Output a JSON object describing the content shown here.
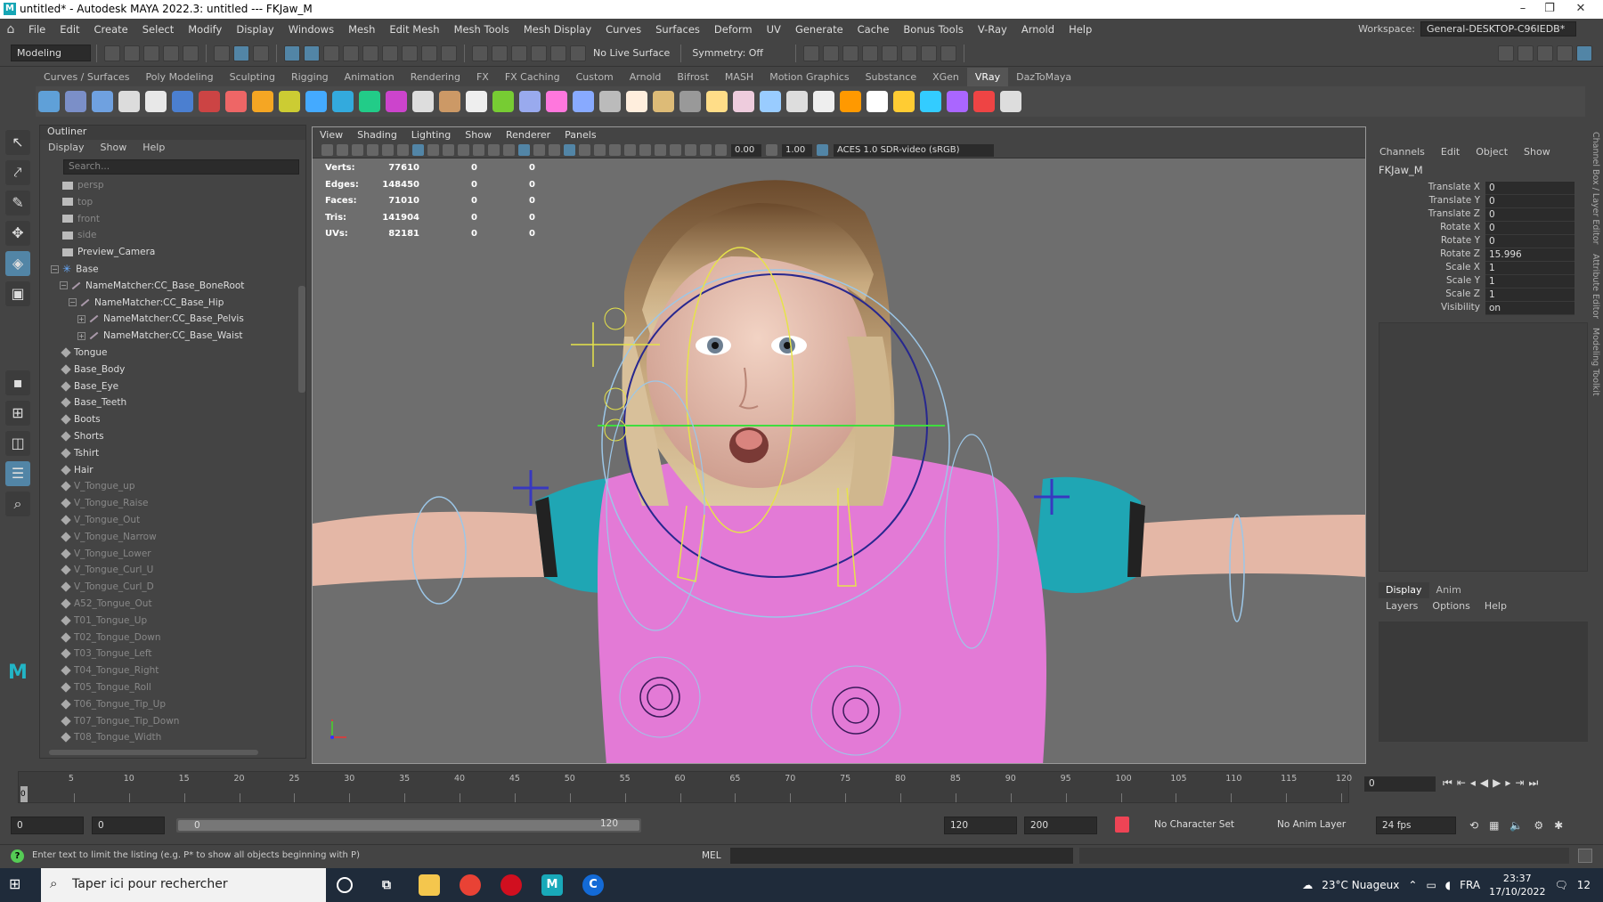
{
  "titlebar": {
    "title": "untitled* - Autodesk MAYA 2022.3: untitled  ---  FKJaw_M",
    "logo": "M",
    "minimize_icon": "–",
    "restore_icon": "❐",
    "close_icon": "✕"
  },
  "menubar": {
    "items": [
      "File",
      "Edit",
      "Create",
      "Select",
      "Modify",
      "Display",
      "Windows",
      "Mesh",
      "Edit Mesh",
      "Mesh Tools",
      "Mesh Display",
      "Curves",
      "Surfaces",
      "Deform",
      "UV",
      "Generate",
      "Cache",
      "Bonus Tools",
      "V-Ray",
      "Arnold",
      "Help"
    ],
    "workspace_label": "Workspace:",
    "workspace_value": "General-DESKTOP-C96IEDB*"
  },
  "statusline": {
    "mode": "Modeling",
    "live_surface": "No Live Surface",
    "symmetry": "Symmetry: Off"
  },
  "shelf": {
    "tabs": [
      "Curves / Surfaces",
      "Poly Modeling",
      "Sculpting",
      "Rigging",
      "Animation",
      "Rendering",
      "FX",
      "FX Caching",
      "Custom",
      "Arnold",
      "Bifrost",
      "MASH",
      "Motion Graphics",
      "Substance",
      "XGen",
      "VRay",
      "DazToMaya"
    ],
    "active_tab": "VRay"
  },
  "outliner": {
    "title": "Outliner",
    "menu": [
      "Display",
      "Show",
      "Help"
    ],
    "search_placeholder": "Search...",
    "items": [
      {
        "label": "persp",
        "type": "camera",
        "indent": 1,
        "dim": true
      },
      {
        "label": "top",
        "type": "camera",
        "indent": 1,
        "dim": true
      },
      {
        "label": "front",
        "type": "camera",
        "indent": 1,
        "dim": true
      },
      {
        "label": "side",
        "type": "camera",
        "indent": 1,
        "dim": true
      },
      {
        "label": "Preview_Camera",
        "type": "camera",
        "indent": 1,
        "dim": false
      },
      {
        "label": "Base",
        "type": "cross",
        "indent": 1,
        "dim": false,
        "expander": "−"
      },
      {
        "label": "NameMatcher:CC_Base_BoneRoot",
        "type": "joint",
        "indent": 2,
        "dim": false,
        "expander": "−"
      },
      {
        "label": "NameMatcher:CC_Base_Hip",
        "type": "joint",
        "indent": 3,
        "dim": false,
        "expander": "−"
      },
      {
        "label": "NameMatcher:CC_Base_Pelvis",
        "type": "joint",
        "indent": 4,
        "dim": false,
        "expander": "+"
      },
      {
        "label": "NameMatcher:CC_Base_Waist",
        "type": "joint",
        "indent": 4,
        "dim": false,
        "expander": "+"
      },
      {
        "label": "Tongue",
        "type": "mesh",
        "indent": 1,
        "dim": false
      },
      {
        "label": "Base_Body",
        "type": "mesh",
        "indent": 1,
        "dim": false
      },
      {
        "label": "Base_Eye",
        "type": "mesh",
        "indent": 1,
        "dim": false
      },
      {
        "label": "Base_Teeth",
        "type": "mesh",
        "indent": 1,
        "dim": false
      },
      {
        "label": "Boots",
        "type": "mesh",
        "indent": 1,
        "dim": false
      },
      {
        "label": "Shorts",
        "type": "mesh",
        "indent": 1,
        "dim": false
      },
      {
        "label": "Tshirt",
        "type": "mesh",
        "indent": 1,
        "dim": false
      },
      {
        "label": "Hair",
        "type": "mesh",
        "indent": 1,
        "dim": false
      },
      {
        "label": "V_Tongue_up",
        "type": "mesh",
        "indent": 1,
        "dim": true
      },
      {
        "label": "V_Tongue_Raise",
        "type": "mesh",
        "indent": 1,
        "dim": true
      },
      {
        "label": "V_Tongue_Out",
        "type": "mesh",
        "indent": 1,
        "dim": true
      },
      {
        "label": "V_Tongue_Narrow",
        "type": "mesh",
        "indent": 1,
        "dim": true
      },
      {
        "label": "V_Tongue_Lower",
        "type": "mesh",
        "indent": 1,
        "dim": true
      },
      {
        "label": "V_Tongue_Curl_U",
        "type": "mesh",
        "indent": 1,
        "dim": true
      },
      {
        "label": "V_Tongue_Curl_D",
        "type": "mesh",
        "indent": 1,
        "dim": true
      },
      {
        "label": "A52_Tongue_Out",
        "type": "mesh",
        "indent": 1,
        "dim": true
      },
      {
        "label": "T01_Tongue_Up",
        "type": "mesh",
        "indent": 1,
        "dim": true
      },
      {
        "label": "T02_Tongue_Down",
        "type": "mesh",
        "indent": 1,
        "dim": true
      },
      {
        "label": "T03_Tongue_Left",
        "type": "mesh",
        "indent": 1,
        "dim": true
      },
      {
        "label": "T04_Tongue_Right",
        "type": "mesh",
        "indent": 1,
        "dim": true
      },
      {
        "label": "T05_Tongue_Roll",
        "type": "mesh",
        "indent": 1,
        "dim": true
      },
      {
        "label": "T06_Tongue_Tip_Up",
        "type": "mesh",
        "indent": 1,
        "dim": true
      },
      {
        "label": "T07_Tongue_Tip_Down",
        "type": "mesh",
        "indent": 1,
        "dim": true
      },
      {
        "label": "T08_Tongue_Width",
        "type": "mesh",
        "indent": 1,
        "dim": true
      }
    ]
  },
  "viewport": {
    "menu": [
      "View",
      "Shading",
      "Lighting",
      "Show",
      "Renderer",
      "Panels"
    ],
    "exposure": "0.00",
    "gamma": "1.00",
    "color_management": "ACES 1.0 SDR-video (sRGB)",
    "hud": [
      {
        "label": "Verts:",
        "v1": "77610",
        "v2": "0",
        "v3": "0"
      },
      {
        "label": "Edges:",
        "v1": "148450",
        "v2": "0",
        "v3": "0"
      },
      {
        "label": "Faces:",
        "v1": "71010",
        "v2": "0",
        "v3": "0"
      },
      {
        "label": "Tris:",
        "v1": "141904",
        "v2": "0",
        "v3": "0"
      },
      {
        "label": "UVs:",
        "v1": "82181",
        "v2": "0",
        "v3": "0"
      }
    ]
  },
  "channelbox": {
    "menu": [
      "Channels",
      "Edit",
      "Object",
      "Show"
    ],
    "object": "FKJaw_M",
    "attributes": [
      {
        "name": "Translate X",
        "value": "0"
      },
      {
        "name": "Translate Y",
        "value": "0"
      },
      {
        "name": "Translate Z",
        "value": "0"
      },
      {
        "name": "Rotate X",
        "value": "0"
      },
      {
        "name": "Rotate Y",
        "value": "0"
      },
      {
        "name": "Rotate Z",
        "value": "15.996"
      },
      {
        "name": "Scale X",
        "value": "1"
      },
      {
        "name": "Scale Y",
        "value": "1"
      },
      {
        "name": "Scale Z",
        "value": "1"
      },
      {
        "name": "Visibility",
        "value": "on"
      }
    ],
    "layer_tabs": [
      "Display",
      "Anim"
    ],
    "layer_menu": [
      "Layers",
      "Options",
      "Help"
    ],
    "side_tabs": [
      "Channel Box / Layer Editor",
      "Attribute Editor",
      "Modeling Toolkit"
    ]
  },
  "timeslider": {
    "ticks": [
      "5",
      "10",
      "15",
      "20",
      "25",
      "30",
      "35",
      "40",
      "45",
      "50",
      "55",
      "60",
      "65",
      "70",
      "75",
      "80",
      "85",
      "90",
      "95",
      "100",
      "105",
      "110",
      "115",
      "120"
    ],
    "current_frame_marker": "0",
    "current_frame": "0"
  },
  "rangeslider": {
    "start": "0",
    "anim_start": "0",
    "range_start": "0",
    "range_end": "120",
    "end": "120",
    "anim_end": "200",
    "character_set": "No Character Set",
    "anim_layer": "No Anim Layer",
    "fps": "24 fps"
  },
  "helpline": {
    "text": "Enter text to limit the listing (e.g. P* to show all objects beginning with P)",
    "mel_label": "MEL"
  },
  "taskbar": {
    "search_placeholder": "Taper ici pour rechercher",
    "weather": "23°C  Nuageux",
    "language": "FRA",
    "time": "23:37",
    "date": "17/10/2022",
    "notifications": "12"
  }
}
